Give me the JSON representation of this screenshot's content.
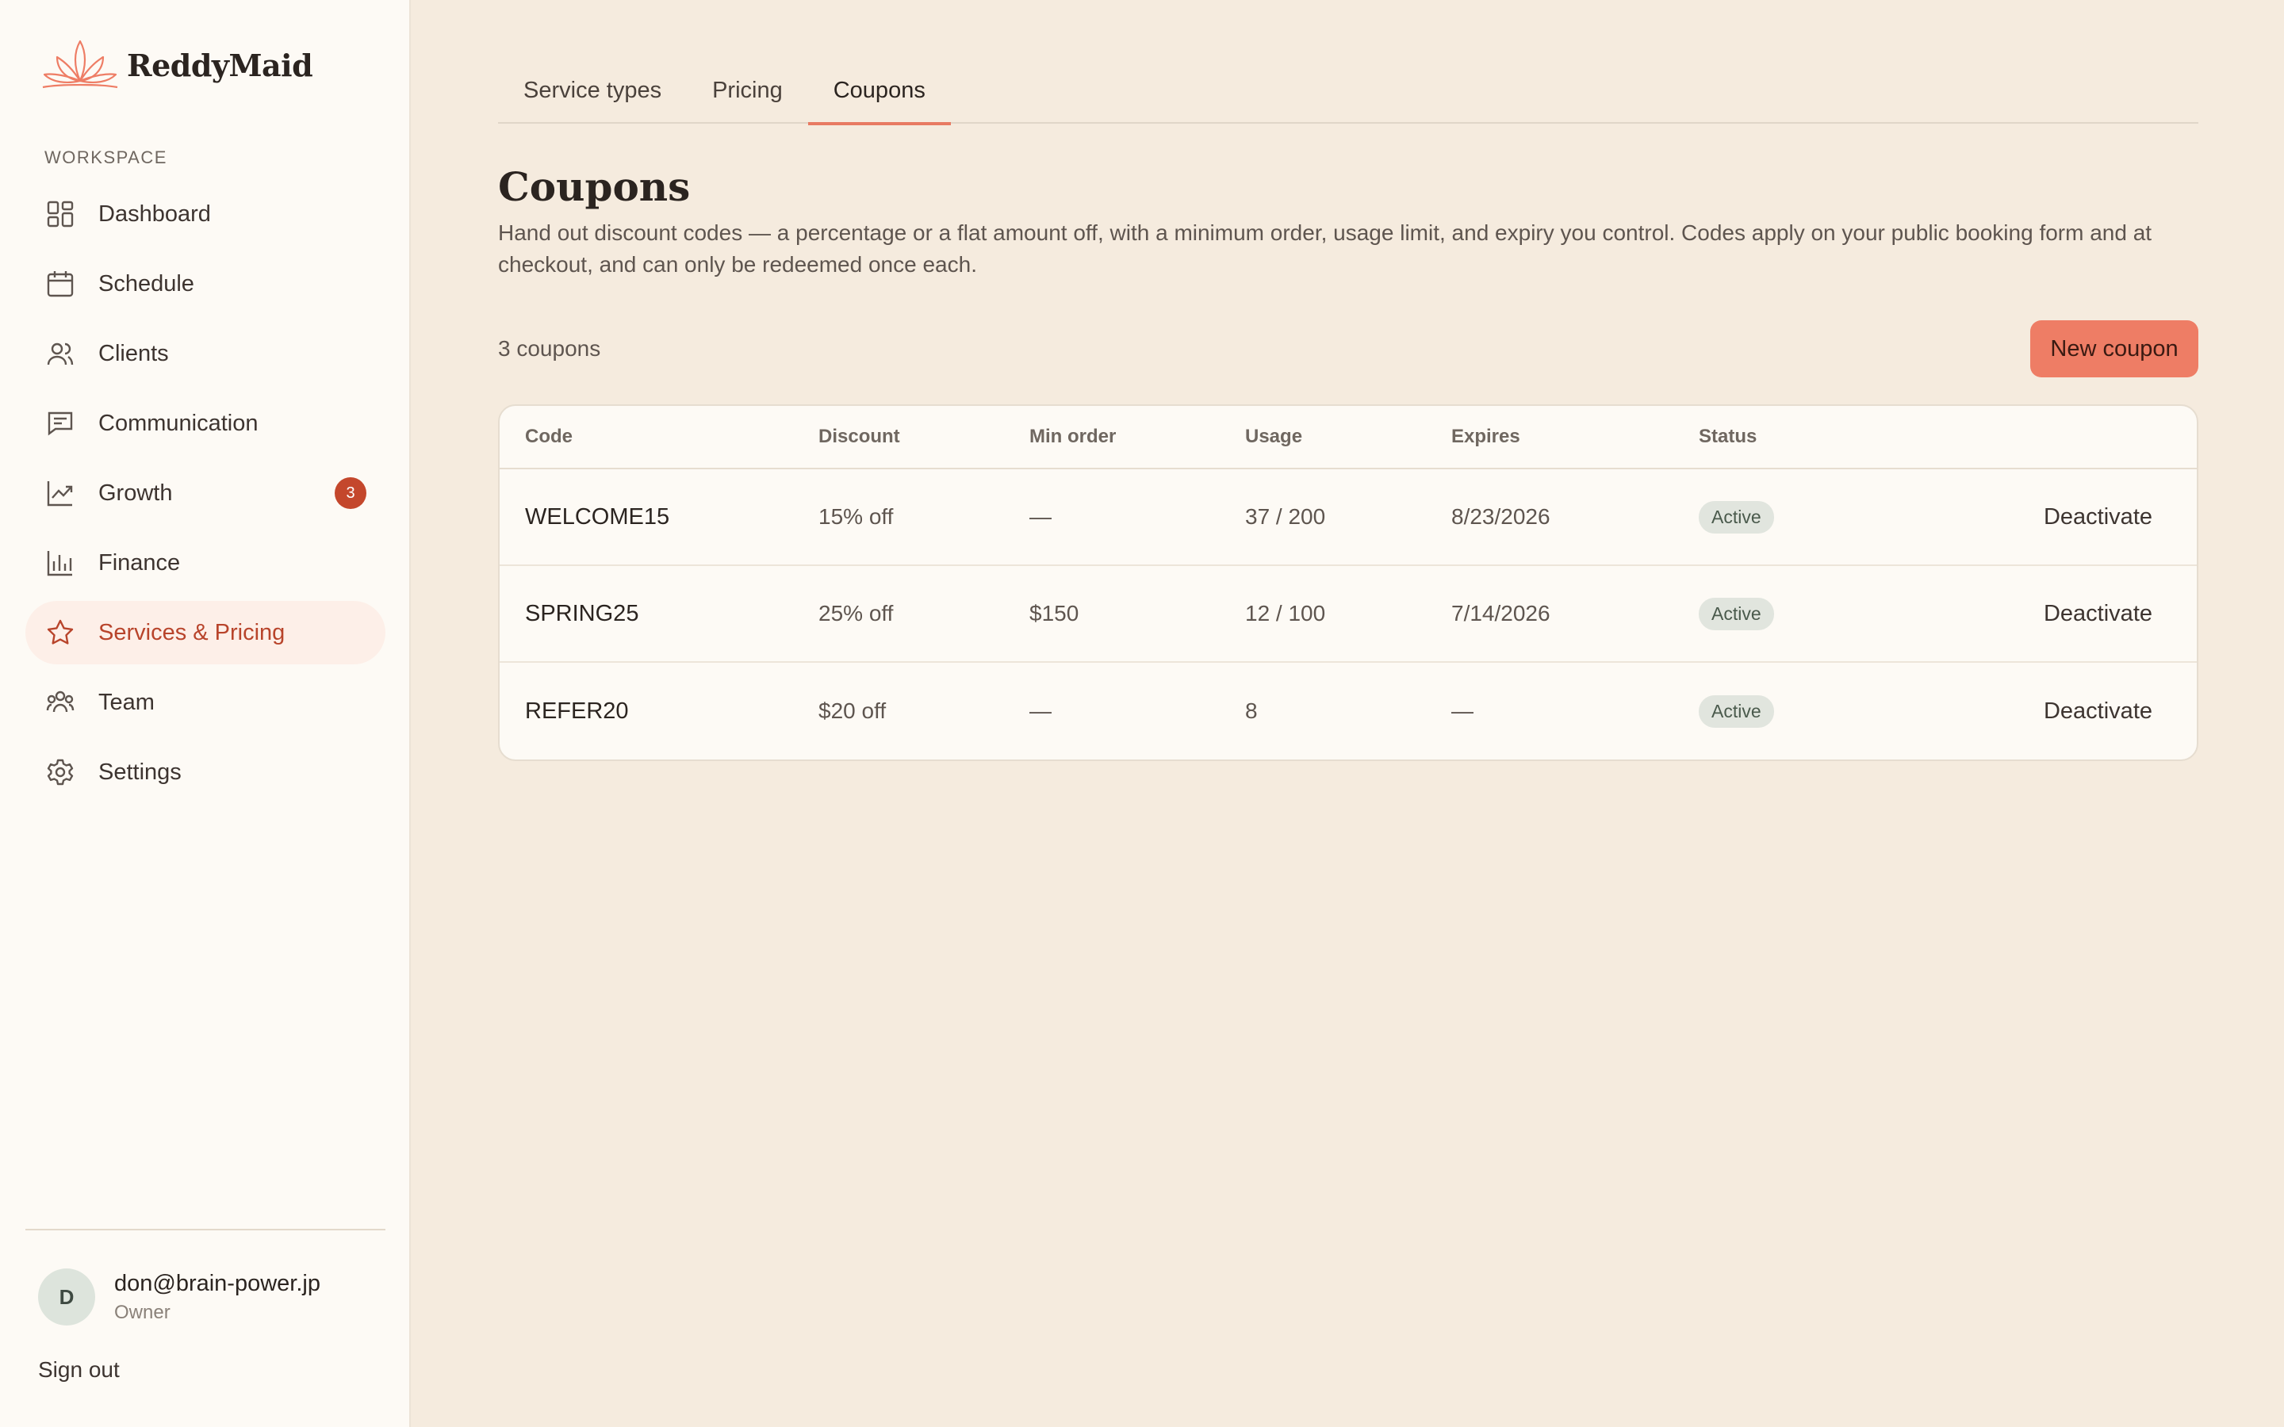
{
  "brand": {
    "name": "ReddyMaid",
    "accent": "#ee7d65"
  },
  "sidebar": {
    "section_label": "WORKSPACE",
    "items": [
      {
        "label": "Dashboard",
        "icon": "grid-icon"
      },
      {
        "label": "Schedule",
        "icon": "calendar-icon"
      },
      {
        "label": "Clients",
        "icon": "users-icon"
      },
      {
        "label": "Communication",
        "icon": "chat-icon"
      },
      {
        "label": "Growth",
        "icon": "trend-icon",
        "badge": "3"
      },
      {
        "label": "Finance",
        "icon": "bar-chart-icon"
      },
      {
        "label": "Services & Pricing",
        "icon": "star-icon",
        "active": true
      },
      {
        "label": "Team",
        "icon": "team-icon"
      },
      {
        "label": "Settings",
        "icon": "gear-icon"
      }
    ],
    "user": {
      "initial": "D",
      "email": "don@brain-power.jp",
      "role": "Owner"
    },
    "sign_out": "Sign out"
  },
  "tabs": [
    {
      "label": "Service types"
    },
    {
      "label": "Pricing"
    },
    {
      "label": "Coupons",
      "active": true
    }
  ],
  "page": {
    "title": "Coupons",
    "description": "Hand out discount codes — a percentage or a flat amount off, with a minimum order, usage limit, and expiry you control. Codes apply on your public booking form and at checkout, and can only be redeemed once each.",
    "count": "3 coupons",
    "new_button": "New coupon"
  },
  "table": {
    "headers": {
      "code": "Code",
      "discount": "Discount",
      "min_order": "Min order",
      "usage": "Usage",
      "expires": "Expires",
      "status": "Status"
    },
    "rows": [
      {
        "code": "WELCOME15",
        "discount": "15% off",
        "min_order": "—",
        "usage": "37 / 200",
        "expires": "8/23/2026",
        "status": "Active",
        "action": "Deactivate"
      },
      {
        "code": "SPRING25",
        "discount": "25% off",
        "min_order": "$150",
        "usage": "12 / 100",
        "expires": "7/14/2026",
        "status": "Active",
        "action": "Deactivate"
      },
      {
        "code": "REFER20",
        "discount": "$20 off",
        "min_order": "—",
        "usage": "8",
        "expires": "—",
        "status": "Active",
        "action": "Deactivate"
      }
    ]
  }
}
